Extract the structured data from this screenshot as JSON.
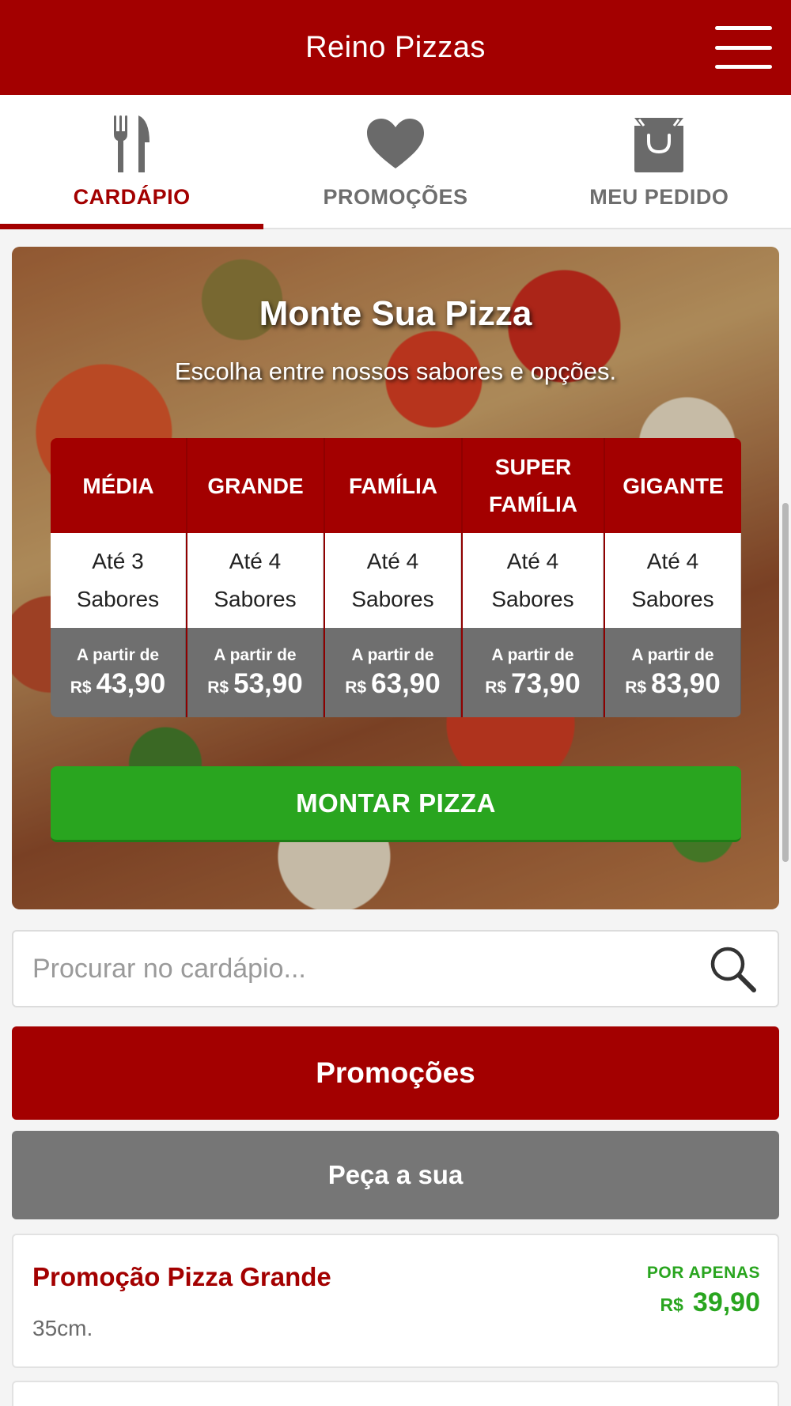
{
  "header": {
    "title": "Reino Pizzas"
  },
  "tabs": [
    {
      "label": "CARDÁPIO",
      "icon": "cutlery-icon",
      "active": true
    },
    {
      "label": "PROMOÇÕES",
      "icon": "heart-icon",
      "active": false
    },
    {
      "label": "MEU PEDIDO",
      "icon": "shopping-bag-icon",
      "active": false
    }
  ],
  "hero": {
    "title": "Monte Sua Pizza",
    "subtitle": "Escolha entre nossos sabores e opções.",
    "sizes": [
      {
        "name_lines": [
          "MÉDIA"
        ],
        "flavors_lines": [
          "Até 3",
          "Sabores"
        ],
        "from": "A partir de",
        "currency": "R$",
        "price": "43,90"
      },
      {
        "name_lines": [
          "GRANDE"
        ],
        "flavors_lines": [
          "Até 4",
          "Sabores"
        ],
        "from": "A partir de",
        "currency": "R$",
        "price": "53,90"
      },
      {
        "name_lines": [
          "FAMÍLIA"
        ],
        "flavors_lines": [
          "Até 4",
          "Sabores"
        ],
        "from": "A partir de",
        "currency": "R$",
        "price": "63,90"
      },
      {
        "name_lines": [
          "SUPER",
          "FAMÍLIA"
        ],
        "flavors_lines": [
          "Até 4",
          "Sabores"
        ],
        "from": "A partir de",
        "currency": "R$",
        "price": "73,90"
      },
      {
        "name_lines": [
          "GIGANTE"
        ],
        "flavors_lines": [
          "Até 4",
          "Sabores"
        ],
        "from": "A partir de",
        "currency": "R$",
        "price": "83,90"
      }
    ],
    "button_label": "MONTAR PIZZA"
  },
  "search": {
    "placeholder": "Procurar no cardápio...",
    "value": ""
  },
  "sections": {
    "promo_label": "Promoções",
    "order_label": "Peça a sua"
  },
  "product": {
    "name": "Promoção Pizza Grande",
    "description": "35cm.",
    "price_label": "POR APENAS",
    "currency": "R$",
    "price": "39,90"
  },
  "colors": {
    "brand": "#a30000",
    "accent_green": "#29a51f",
    "neutral_gray": "#767676"
  }
}
